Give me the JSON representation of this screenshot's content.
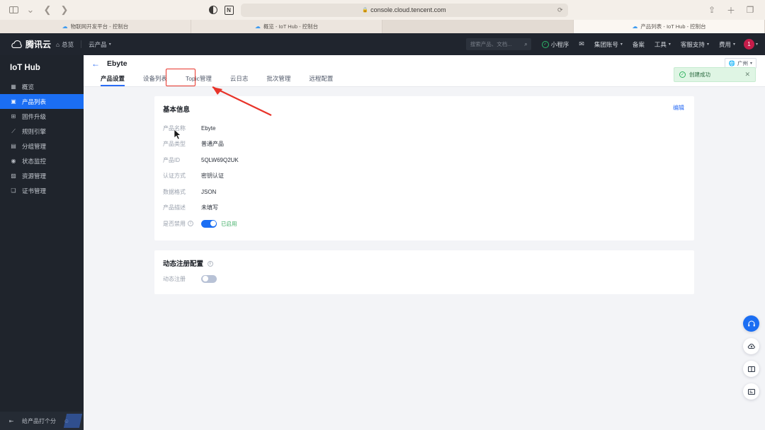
{
  "browser": {
    "url": "console.cloud.tencent.com",
    "lock_icon": "lock-icon",
    "nav_back": "back-icon",
    "nav_forward": "forward-icon",
    "sidebar_toggle": "sidebar-toggle-icon",
    "contrast_icon": "reader-contrast-icon",
    "extension_icon": "notion-extension-icon",
    "reload_icon": "reload-icon",
    "share_icon": "share-icon",
    "newtab_icon": "plus-icon",
    "tabs_icon": "tab-overview-icon",
    "tabs": [
      {
        "title": "物联网开发平台 - 控制台",
        "icon": "cloud-icon",
        "state": "inactive"
      },
      {
        "title": "概览 - IoT Hub - 控制台",
        "icon": "cloud-icon",
        "state": "inactive"
      },
      {
        "title": "",
        "icon": "",
        "state": "dim"
      },
      {
        "title": "产品列表 - IoT Hub - 控制台",
        "icon": "cloud-icon",
        "state": "active"
      }
    ]
  },
  "topnav": {
    "brand": "腾讯云",
    "brand_icon": "tencent-cloud-logo",
    "home_label": "总览",
    "home_icon": "home-icon",
    "products_label": "云产品",
    "search_placeholder": "搜索产品、文档...",
    "search_icon": "search-icon",
    "items": [
      {
        "label": "小程序",
        "icon": "mini-program-icon"
      },
      {
        "label": "",
        "icon": "mail-icon"
      },
      {
        "label": "集团账号",
        "icon": "caret-down-icon"
      },
      {
        "label": "备案",
        "icon": ""
      },
      {
        "label": "工具",
        "icon": "caret-down-icon"
      },
      {
        "label": "客服支持",
        "icon": "caret-down-icon"
      },
      {
        "label": "费用",
        "icon": "caret-down-icon"
      }
    ],
    "avatar_label": "1"
  },
  "sidebar": {
    "title": "IoT Hub",
    "items": [
      {
        "label": "概览",
        "icon": "dashboard-icon",
        "selected": false
      },
      {
        "label": "产品列表",
        "icon": "product-list-icon",
        "selected": true
      },
      {
        "label": "固件升级",
        "icon": "firmware-upgrade-icon",
        "selected": false
      },
      {
        "label": "规则引擎",
        "icon": "rule-engine-icon",
        "selected": false
      },
      {
        "label": "分组管理",
        "icon": "group-manage-icon",
        "selected": false
      },
      {
        "label": "状态监控",
        "icon": "status-monitor-icon",
        "selected": false
      },
      {
        "label": "资源管理",
        "icon": "resource-manage-icon",
        "selected": false
      },
      {
        "label": "证书管理",
        "icon": "certificate-icon",
        "selected": false
      }
    ],
    "footer_label": "给产品打个分",
    "footer_icon": "collapse-icon",
    "footer_end_icon": "star-rate-icon"
  },
  "page": {
    "back_icon": "back-arrow-icon",
    "title": "Ebyte",
    "region": {
      "label": "广州",
      "icon": "globe-icon"
    },
    "tabs": [
      {
        "label": "产品设置",
        "active": true
      },
      {
        "label": "设备列表",
        "active": false
      },
      {
        "label": "Topic管理",
        "active": false,
        "highlighted": true
      },
      {
        "label": "云日志",
        "active": false
      },
      {
        "label": "批次管理",
        "active": false
      },
      {
        "label": "远程配置",
        "active": false
      }
    ]
  },
  "basic_info": {
    "title": "基本信息",
    "edit_label": "编辑",
    "rows": [
      {
        "label": "产品名称",
        "value": "Ebyte"
      },
      {
        "label": "产品类型",
        "value": "普通产品"
      },
      {
        "label": "产品ID",
        "value": "5QLW69Q2UK"
      },
      {
        "label": "认证方式",
        "value": "密钥认证"
      },
      {
        "label": "数据格式",
        "value": "JSON"
      },
      {
        "label": "产品描述",
        "value": "未填写"
      }
    ],
    "toggle_row": {
      "label": "是否禁用",
      "info_icon": "info-icon",
      "state": "on",
      "state_text": "已启用"
    }
  },
  "dynamic_register": {
    "title": "动态注册配置",
    "info_icon": "info-icon",
    "label": "动态注册",
    "state": "off"
  },
  "toast": {
    "icon": "success-check-icon",
    "message": "创建成功",
    "close_icon": "close-icon"
  },
  "fabs": [
    {
      "name": "support-headset-icon",
      "glyph": "☏",
      "primary": true
    },
    {
      "name": "cloud-upload-icon",
      "glyph": "☁",
      "primary": false
    },
    {
      "name": "documentation-book-icon",
      "glyph": "▤",
      "primary": false
    },
    {
      "name": "feedback-list-icon",
      "glyph": "☰",
      "primary": false
    }
  ]
}
